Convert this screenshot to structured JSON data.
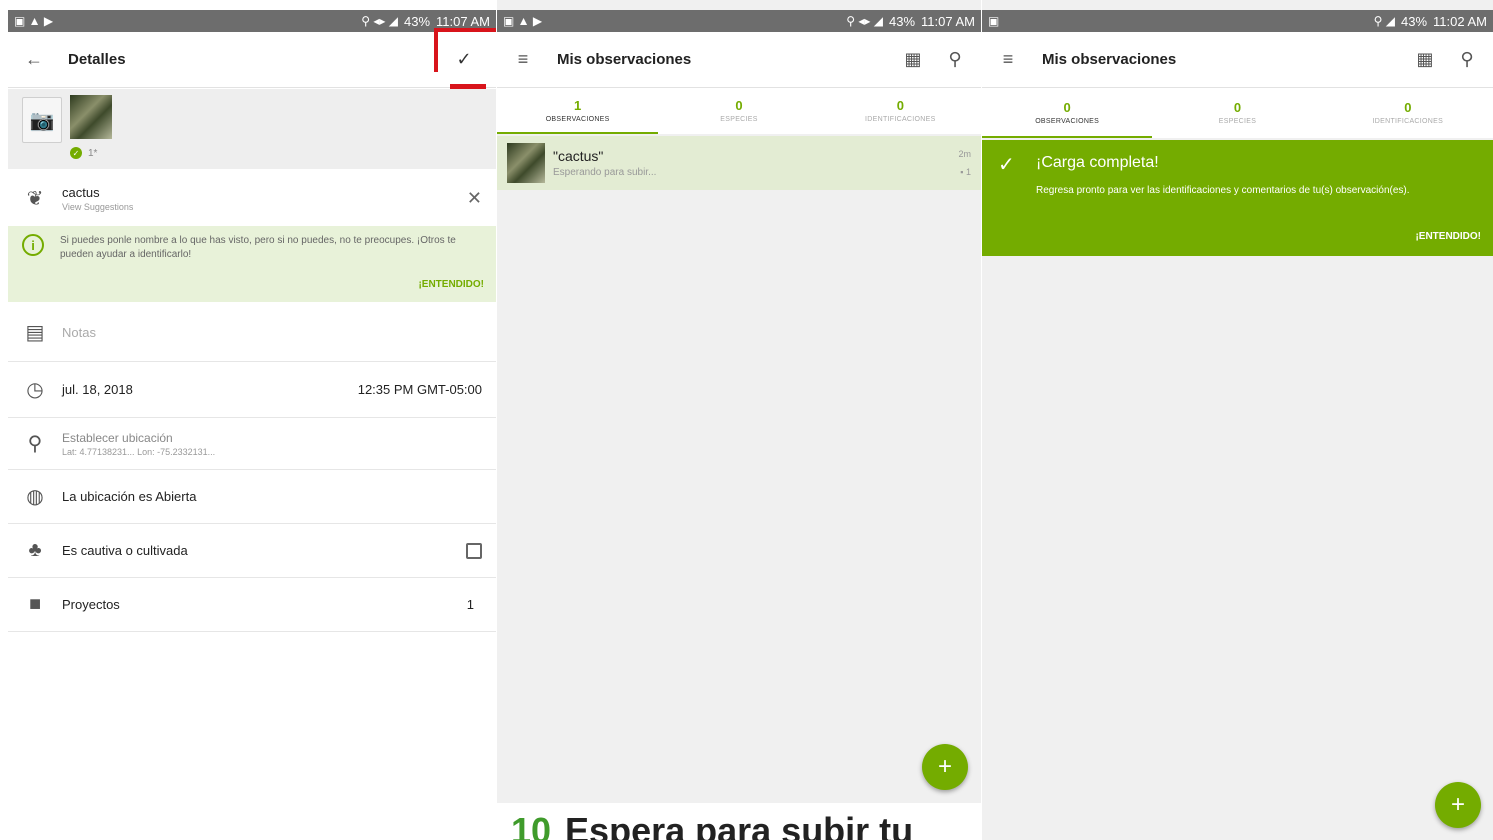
{
  "colors": {
    "accent": "#74ac00",
    "highlight": "#d8141b",
    "tip_bg": "#e8f2d9",
    "status_bar": "#6d6d6d"
  },
  "screen1": {
    "status": {
      "time": "11:07 AM",
      "battery": "43%"
    },
    "appbar": {
      "title": "Detalles",
      "back_icon": "arrow-left-icon",
      "confirm_icon": "check-icon"
    },
    "photo": {
      "count": "1*"
    },
    "species": {
      "name": "cactus",
      "suggestions": "View Suggestions"
    },
    "tip": {
      "message": "Si puedes ponle nombre a lo que has visto, pero si no puedes, no te preocupes. ¡Otros te pueden ayudar a identificarlo!",
      "action": "¡ENTENDIDO!"
    },
    "notes": {
      "placeholder": "Notas"
    },
    "datetime": {
      "date": "jul. 18, 2018",
      "time": "12:35 PM GMT-05:00"
    },
    "location": {
      "label": "Establecer ubicación",
      "coords": "Lat: 4.77138231... Lon: -75.2332131..."
    },
    "privacy": {
      "label": "La ubicación es Abierta"
    },
    "captive": {
      "label": "Es cautiva o cultivada"
    },
    "projects": {
      "label": "Proyectos",
      "count": "1"
    }
  },
  "screen2": {
    "status": {
      "time": "11:07 AM",
      "battery": "43%"
    },
    "appbar": {
      "title": "Mis observaciones"
    },
    "tabs": [
      {
        "num": "1",
        "label": "OBSERVACIONES"
      },
      {
        "num": "0",
        "label": "ESPECIES"
      },
      {
        "num": "0",
        "label": "IDENTIFICACIONES"
      }
    ],
    "observation": {
      "name": "\"cactus\"",
      "state": "Esperando para subir...",
      "age": "2m",
      "count": "1"
    },
    "fab": "+",
    "step": {
      "number": "10",
      "text": "Espera para subir tu"
    }
  },
  "screen3": {
    "status": {
      "time": "11:02 AM",
      "battery": "43%"
    },
    "appbar": {
      "title": "Mis observaciones"
    },
    "tabs": [
      {
        "num": "0",
        "label": "OBSERVACIONES"
      },
      {
        "num": "0",
        "label": "ESPECIES"
      },
      {
        "num": "0",
        "label": "IDENTIFICACIONES"
      }
    ],
    "banner": {
      "title": "¡Carga completa!",
      "message": "Regresa pronto para ver las identificaciones y comentarios de tu(s) observación(es).",
      "action": "¡ENTENDIDO!"
    },
    "fab": "+"
  }
}
